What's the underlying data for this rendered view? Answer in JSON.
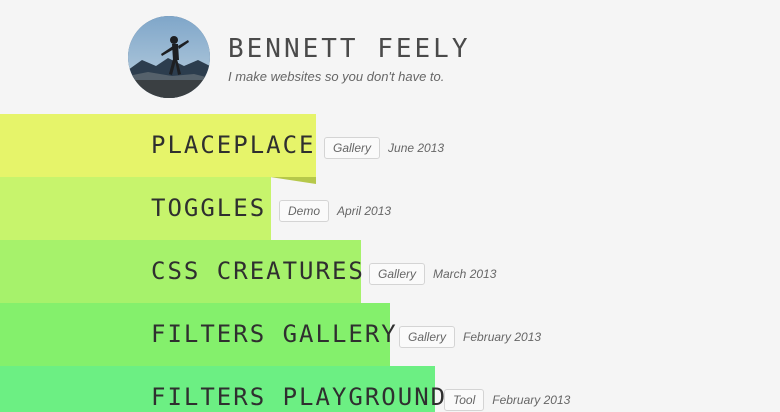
{
  "header": {
    "name": "BENNETT FEELY",
    "tagline": "I make websites so you don't have to."
  },
  "projects": [
    {
      "title": "PLACEPLACE",
      "tag": "Gallery",
      "date": "June 2013",
      "color": "#e6f46a"
    },
    {
      "title": "TOGGLES",
      "tag": "Demo",
      "date": "April 2013",
      "color": "#c7f46c"
    },
    {
      "title": "CSS CREATURES",
      "tag": "Gallery",
      "date": "March 2013",
      "color": "#a6f26b"
    },
    {
      "title": "FILTERS GALLERY",
      "tag": "Gallery",
      "date": "February 2013",
      "color": "#84f06c"
    },
    {
      "title": "FILTERS PLAYGROUND",
      "tag": "Tool",
      "date": "February 2013",
      "color": "#6cef83"
    }
  ],
  "colors": {
    "background": "#f5f5f5",
    "text": "#444444",
    "fold_accent": "#b6c84a"
  }
}
